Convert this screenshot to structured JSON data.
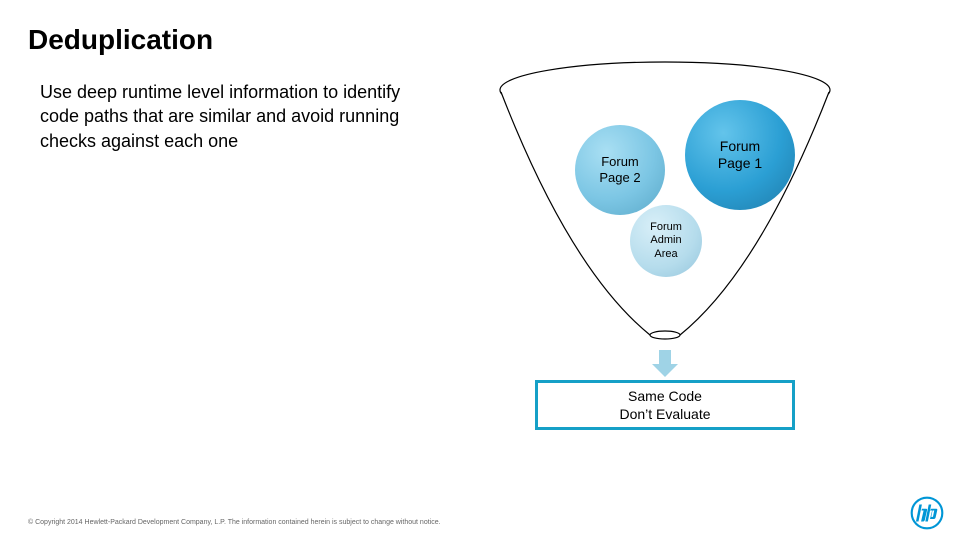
{
  "title": "Deduplication",
  "subtitle": "Use deep runtime level information to identify code paths that are similar and avoid running checks against each one",
  "funnel": {
    "bubble1": "Forum\nPage 1",
    "bubble2": "Forum\nPage 2",
    "bubble3": "Forum\nAdmin\nArea"
  },
  "output": {
    "line1": "Same Code",
    "line2": "Don’t Evaluate"
  },
  "footer": "© Copyright 2014 Hewlett-Packard Development Company, L.P.  The information contained herein is subject to change without notice.",
  "logo_name": "hp-logo",
  "colors": {
    "accent": "#16a0c7",
    "hp_blue": "#0096d6"
  }
}
